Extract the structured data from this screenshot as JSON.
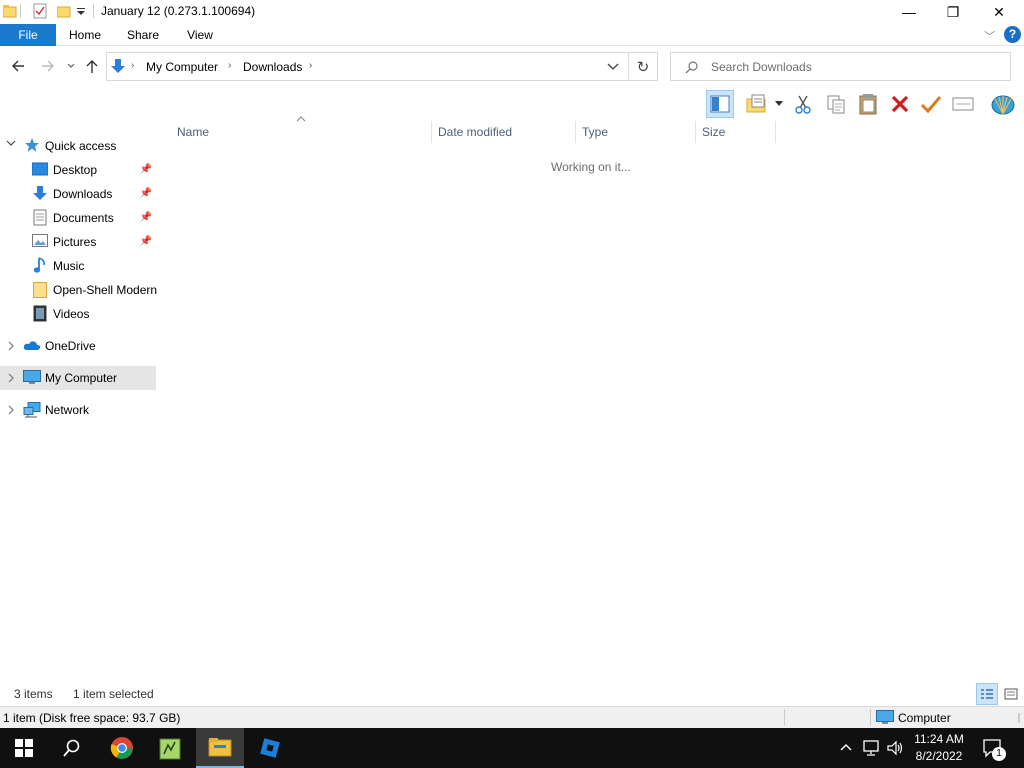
{
  "window": {
    "title": "January 12 (0.273.1.100694)",
    "minimize_glyph": "—",
    "restore_glyph": "❐",
    "close_glyph": "✕"
  },
  "ribbon": {
    "tabs": [
      {
        "label": "File"
      },
      {
        "label": "Home"
      },
      {
        "label": "Share"
      },
      {
        "label": "View"
      }
    ],
    "help_glyph": "?"
  },
  "address": {
    "breadcrumb": [
      "My Computer",
      "Downloads"
    ],
    "search_placeholder": "Search Downloads"
  },
  "nav": {
    "quick_access": "Quick access",
    "quick_items": [
      {
        "label": "Desktop",
        "icon": "desktop-icon",
        "pinned": true
      },
      {
        "label": "Downloads",
        "icon": "downloads-icon",
        "pinned": true
      },
      {
        "label": "Documents",
        "icon": "documents-icon",
        "pinned": true
      },
      {
        "label": "Pictures",
        "icon": "pictures-icon",
        "pinned": true
      },
      {
        "label": "Music",
        "icon": "music-icon",
        "pinned": false
      },
      {
        "label": "Open-Shell Modern",
        "icon": "folder-icon",
        "pinned": false
      },
      {
        "label": "Videos",
        "icon": "videos-icon",
        "pinned": false
      }
    ],
    "onedrive": "OneDrive",
    "my_computer": "My Computer",
    "network": "Network"
  },
  "content": {
    "columns": [
      "Name",
      "Date modified",
      "Type",
      "Size"
    ],
    "loading_text": "Working on it..."
  },
  "status": {
    "items": "3 items",
    "selected": "1 item selected",
    "disk": "1 item (Disk free space: 93.7 GB)",
    "location": "Computer"
  },
  "taskbar": {
    "time": "11:24 AM",
    "date": "8/2/2022",
    "notification_count": "1"
  },
  "colors": {
    "accent": "#1979ca",
    "taskbar": "#101010",
    "selected_nav": "#e5e5e5"
  }
}
